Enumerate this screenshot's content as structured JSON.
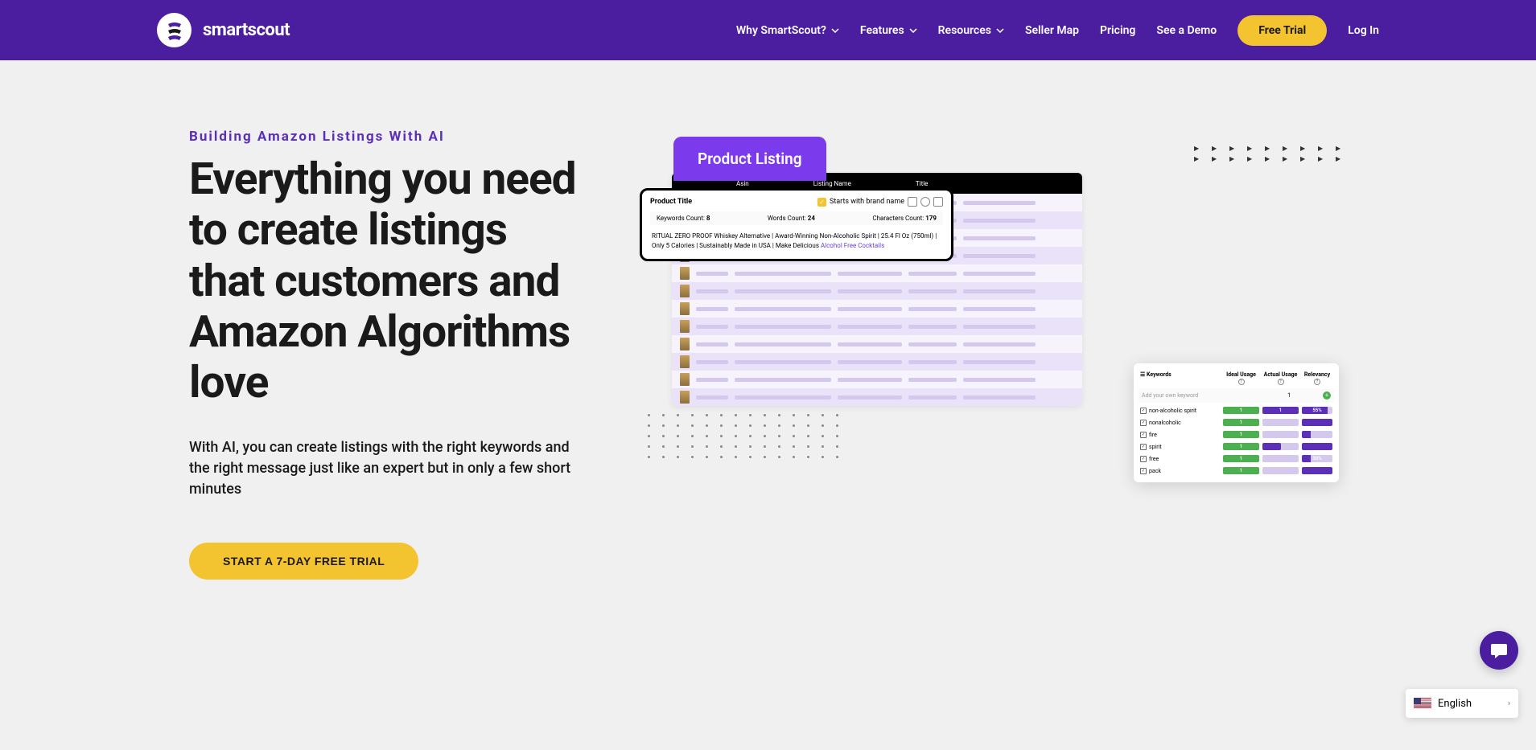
{
  "brand": "smartscout",
  "nav": {
    "why": "Why SmartScout?",
    "features": "Features",
    "resources": "Resources",
    "sellermap": "Seller Map",
    "pricing": "Pricing",
    "demo": "See a Demo",
    "trial": "Free Trial",
    "login": "Log In"
  },
  "hero": {
    "eyebrow": "Building Amazon Listings With AI",
    "headline": "Everything you need to create listings that customers and Amazon Algorithms love",
    "subhead": "With AI, you can create listings with the right keywords and the right message just like an expert but in only a few short minutes",
    "cta": "START A 7-DAY FREE TRIAL"
  },
  "illustration": {
    "tab": "Product Listing",
    "bgHeaders": {
      "asin": "Asin",
      "listing": "Listing Name",
      "title": "Title"
    },
    "productCard": {
      "title": "Product Title",
      "brandCheck": "Starts with brand name",
      "stats": {
        "kwLabel": "Keywords Count:",
        "kwVal": "8",
        "wLabel": "Words Count:",
        "wVal": "24",
        "cLabel": "Characters Count:",
        "cVal": "179"
      },
      "text1": "RITUAL ZERO PROOF Whiskey Alternative | Award-Winning Non-Alcoholic Spirit | 25.4 Fl Oz (750ml) | Only 5 Calories | Sustainably Made in USA | Make Delicious ",
      "textHL": "Alcohol Free Cocktails"
    },
    "keywords": {
      "hKw": "Keywords",
      "hIdeal": "Ideal Usage",
      "hActual": "Actual Usage",
      "hRel": "Relevancy",
      "addPlaceholder": "Add your own keyword",
      "addCount": "1",
      "rows": [
        {
          "kw": "non-alcoholic spirit",
          "ideal": "1",
          "actual": "1",
          "actualFill": "full",
          "rel": "55%",
          "relFill": "p85"
        },
        {
          "kw": "nonalcoholic",
          "ideal": "1",
          "actual": "",
          "actualFill": "none",
          "rel": "",
          "relFill": "full"
        },
        {
          "kw": "fire",
          "ideal": "1",
          "actual": "",
          "actualFill": "none",
          "rel": "",
          "relFill": "p30"
        },
        {
          "kw": "spirit",
          "ideal": "1",
          "actual": "1",
          "actualFill": "p50",
          "rel": "",
          "relFill": "full"
        },
        {
          "kw": "free",
          "ideal": "1",
          "actual": "",
          "actualFill": "none",
          "rel": "30%",
          "relFill": "p30"
        },
        {
          "kw": "pack",
          "ideal": "1",
          "actual": "",
          "actualFill": "none",
          "rel": "",
          "relFill": "full"
        }
      ]
    }
  },
  "lang": "English"
}
